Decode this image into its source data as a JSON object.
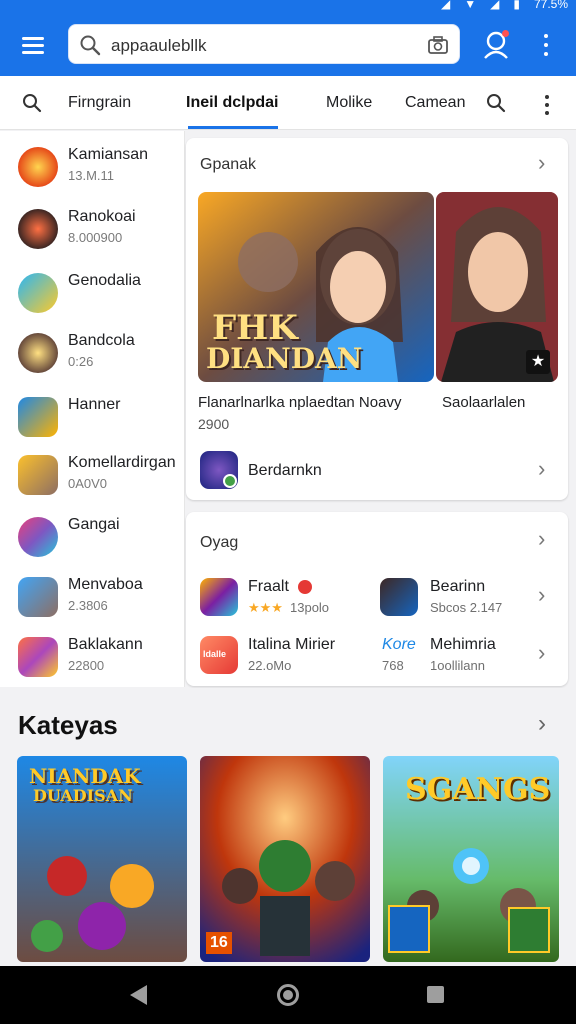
{
  "status_bar": {
    "battery_text": "77.5%"
  },
  "appbar": {
    "search_value": "appaaulebllk",
    "accent": "#1a73e8"
  },
  "tabs": [
    {
      "label": "Firngrain"
    },
    {
      "label": "Ineil dclpdai"
    },
    {
      "label": "Molike"
    },
    {
      "label": "Camean"
    }
  ],
  "left_list": [
    {
      "name": "Kamiansan",
      "sub": "13.M.11",
      "icon": "game-icon-1"
    },
    {
      "name": "Ranokoai",
      "sub": "8.000900",
      "icon": "game-icon-2"
    },
    {
      "name": "Genodalia",
      "sub": "",
      "icon": "game-icon-3"
    },
    {
      "name": "Bandcola",
      "sub": "0:26",
      "icon": "game-icon-4"
    },
    {
      "name": "Hanner",
      "sub": "",
      "icon": "game-icon-5"
    },
    {
      "name": "Komellardirgan",
      "sub": "0A0V0",
      "icon": "game-icon-6"
    },
    {
      "name": "Gangai",
      "sub": "",
      "icon": "game-icon-7"
    },
    {
      "name": "Menvaboa",
      "sub": "2.3806",
      "icon": "game-icon-8"
    },
    {
      "name": "Baklakann",
      "sub": "22800",
      "icon": "game-icon-9"
    }
  ],
  "featured_card": {
    "title": "Gpanak",
    "banner_text_line1": "FHK",
    "banner_text_line2": "DIANDAN",
    "caption_left": "Flanarlnarlka nplaedtan Noavy",
    "caption_right": "Saolaarlalen",
    "caption_sub": "2900",
    "app_name": "Berdarnkn"
  },
  "games_card": {
    "title": "Oyag",
    "items": [
      {
        "name": "Fraalt",
        "sub": "13polo",
        "stars": "★★★",
        "icon": "game-icon-10"
      },
      {
        "name": "Bearinn",
        "sub": "Sbcos 2.147",
        "icon": "game-icon-11"
      },
      {
        "name": "Italina Mirier",
        "sub": "22.oMo",
        "icon": "game-icon-12",
        "icon_label": "Idalle"
      },
      {
        "name": "Mehimria",
        "sub": "1oollilann",
        "icon_label": "Kore",
        "icon_sub": "768"
      }
    ]
  },
  "categories": {
    "title": "Kateyas",
    "cards": [
      {
        "art_text_line1": "NIANDAK",
        "art_text_line2": "DUADISAN"
      },
      {
        "badge": "16"
      },
      {
        "art_text": "SGANGS"
      }
    ]
  }
}
